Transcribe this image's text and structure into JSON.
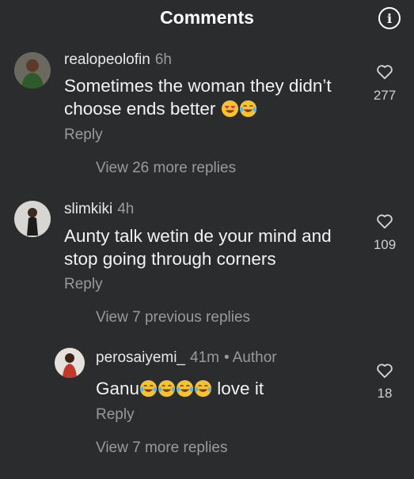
{
  "header": {
    "title": "Comments",
    "info_icon": "info-icon"
  },
  "comments": [
    {
      "username": "realopeolofin",
      "time": "6h",
      "text": "Sometimes the woman they didn’t choose ends better",
      "emojis": [
        "heart-eyes-emoji",
        "laughing-tears-emoji"
      ],
      "reply_label": "Reply",
      "likes": "277",
      "view_replies": "View 26 more replies"
    },
    {
      "username": "slimkiki",
      "time": "4h",
      "text_line1": "Aunty talk wetin de your mind and",
      "text_line2": "stop going through corners",
      "reply_label": "Reply",
      "likes": "109",
      "view_previous": "View 7 previous replies",
      "reply": {
        "username": "perosaiyemi_",
        "time": "41m",
        "author_tag": "Author",
        "text_before": "Ganu",
        "text_after": " love it",
        "emojis": [
          "laughing-tears-emoji",
          "laughing-tears-emoji",
          "laughing-tears-emoji",
          "laughing-tears-emoji"
        ],
        "reply_label": "Reply",
        "likes": "18",
        "view_more": "View 7 more replies"
      }
    }
  ],
  "colors": {
    "background": "#2b2c2e",
    "muted": "#9a9a9a",
    "emoji": "#f7c32e"
  }
}
